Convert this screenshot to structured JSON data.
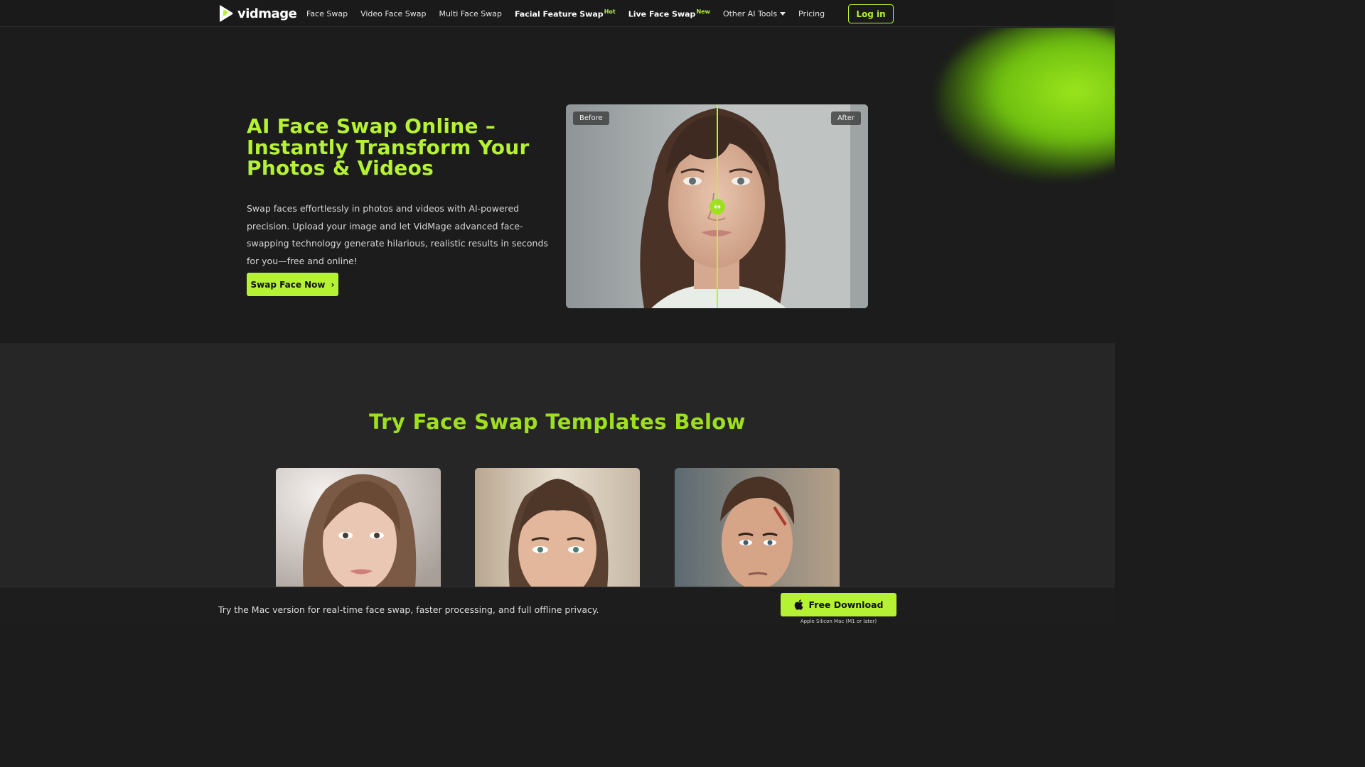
{
  "brand": {
    "name": "vidmage",
    "logo_icon": "play-face-logo-icon"
  },
  "nav": {
    "items": [
      {
        "label": "Face Swap",
        "badge": ""
      },
      {
        "label": "Video Face Swap",
        "badge": ""
      },
      {
        "label": "Multi Face Swap",
        "badge": ""
      },
      {
        "label": "Facial Feature Swap",
        "badge": "Hot"
      },
      {
        "label": "Live Face Swap",
        "badge": "New"
      },
      {
        "label": "Other AI Tools",
        "badge": ""
      },
      {
        "label": "Pricing",
        "badge": ""
      }
    ],
    "login_label": "Log in"
  },
  "hero": {
    "title": "AI Face Swap Online – Instantly Transform Your Photos & Videos",
    "description": "Swap faces effortlessly in photos and videos with AI-powered precision. Upload your image and let VidMage advanced face-swapping technology generate hilarious, realistic results in seconds for you—free and online!",
    "cta_label": "Swap Face Now",
    "cta_icon": "chevron-right-icon",
    "compare": {
      "before_label": "Before",
      "after_label": "After",
      "slider_icon": "left-right-arrows-icon",
      "slider_position": 0.5
    }
  },
  "templates": {
    "title": "Try Face Swap Templates Below",
    "cards": [
      {
        "subject": "woman-light-brown-hair"
      },
      {
        "subject": "woman-dark-hair-updo"
      },
      {
        "subject": "man-scar-face"
      }
    ]
  },
  "bottom_bar": {
    "text": "Try the Mac version for real-time face swap, faster processing, and full offline privacy.",
    "download_label": "Free Download",
    "download_icon": "apple-icon",
    "note": "Apple Silicon Mac (M1 or later)"
  },
  "colors": {
    "accent": "#b5f233",
    "accent_dark": "#9ee01f",
    "background": "#1c1c1c",
    "section_bg": "#262626"
  }
}
